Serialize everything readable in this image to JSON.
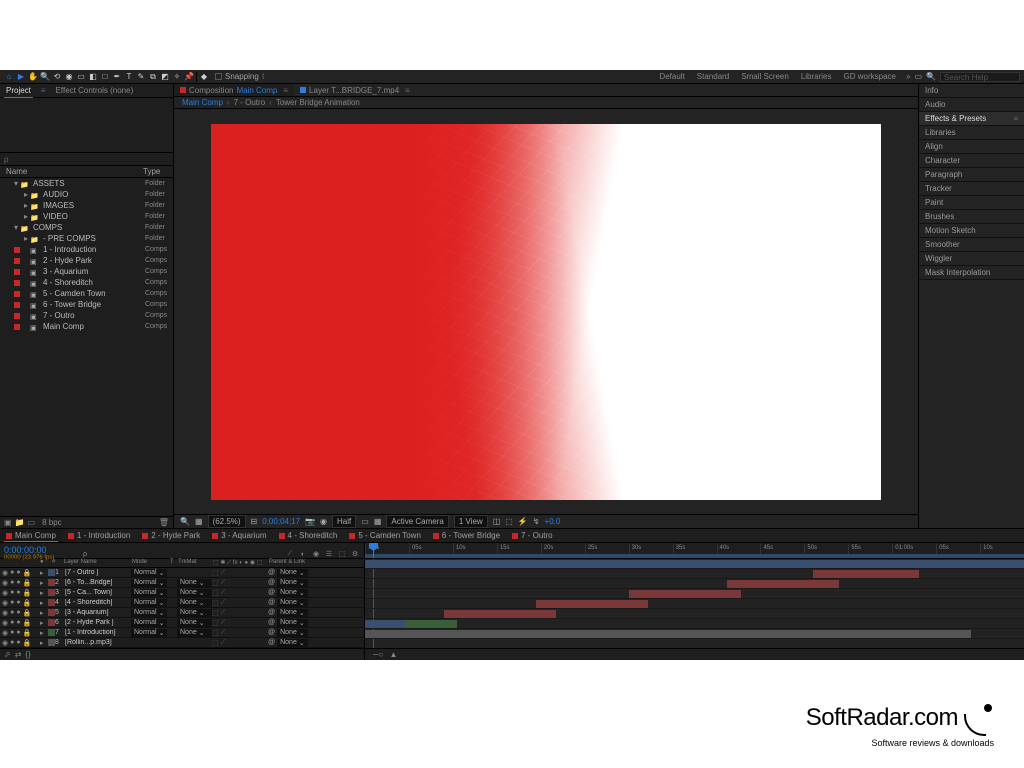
{
  "toolbar": {
    "snapping_label": "Snapping",
    "workspaces": [
      "Default",
      "Standard",
      "Small Screen",
      "Libraries",
      "GD workspace"
    ],
    "search_placeholder": "Search Help"
  },
  "project_panel": {
    "tabs": [
      "Project",
      "Effect Controls (none)"
    ],
    "header_name": "Name",
    "header_type": "Type",
    "search_placeholder": "ρ",
    "tree": [
      {
        "label": "ASSETS",
        "type": "Folder",
        "kind": "folder",
        "depth": 0,
        "swatch": "none",
        "open": true
      },
      {
        "label": "AUDIO",
        "type": "Folder",
        "kind": "folder",
        "depth": 1,
        "swatch": "none"
      },
      {
        "label": "IMAGES",
        "type": "Folder",
        "kind": "folder",
        "depth": 1,
        "swatch": "none"
      },
      {
        "label": "VIDEO",
        "type": "Folder",
        "kind": "folder",
        "depth": 1,
        "swatch": "none"
      },
      {
        "label": "COMPS",
        "type": "Folder",
        "kind": "folder",
        "depth": 0,
        "swatch": "none",
        "open": true
      },
      {
        "label": "- PRE COMPS",
        "type": "Folder",
        "kind": "folder",
        "depth": 1,
        "swatch": "none"
      },
      {
        "label": "1 - Introduction",
        "type": "Comps",
        "kind": "comp",
        "depth": 1,
        "swatch": "#c62828"
      },
      {
        "label": "2 - Hyde Park",
        "type": "Comps",
        "kind": "comp",
        "depth": 1,
        "swatch": "#c62828"
      },
      {
        "label": "3 - Aquarium",
        "type": "Comps",
        "kind": "comp",
        "depth": 1,
        "swatch": "#c62828"
      },
      {
        "label": "4 - Shoreditch",
        "type": "Comps",
        "kind": "comp",
        "depth": 1,
        "swatch": "#c62828"
      },
      {
        "label": "5 - Camden Town",
        "type": "Comps",
        "kind": "comp",
        "depth": 1,
        "swatch": "#c62828"
      },
      {
        "label": "6 - Tower Bridge",
        "type": "Comps",
        "kind": "comp",
        "depth": 1,
        "swatch": "#c62828"
      },
      {
        "label": "7 - Outro",
        "type": "Comps",
        "kind": "comp",
        "depth": 1,
        "swatch": "#c62828"
      },
      {
        "label": "Main Comp",
        "type": "Comps",
        "kind": "comp",
        "depth": 1,
        "swatch": "#c62828"
      }
    ]
  },
  "viewer": {
    "tabs": [
      {
        "sq": "#c62828",
        "lbl": "Composition",
        "name": "Main Comp",
        "active": true
      },
      {
        "sq": "#2a7de1",
        "lbl": "Layer T...BRIDGE_7.mp4",
        "name": "",
        "active": false
      }
    ],
    "breadcrumb": [
      "Main Comp",
      "7 - Outro",
      "Tower Bridge Animation"
    ],
    "controls": {
      "zoom": "(62.5%)",
      "timecode": "0;00;04;17",
      "res": "Half",
      "camera": "Active Camera",
      "view": "1 View",
      "exposure": "+0.0"
    }
  },
  "right_panels": [
    "Info",
    "Audio",
    "Effects & Presets",
    "Libraries",
    "Align",
    "Character",
    "Paragraph",
    "Tracker",
    "Paint",
    "Brushes",
    "Motion Sketch",
    "Smoother",
    "Wiggler",
    "Mask Interpolation"
  ],
  "timeline": {
    "tabs": [
      "Main Comp",
      "1 - Introduction",
      "2 - Hyde Park",
      "3 - Aquarium",
      "4 - Shoreditch",
      "5 - Camden Town",
      "6 - Tower Bridge",
      "7 - Outro"
    ],
    "timecode": "0:00:00:00",
    "timestamp": "00000 (23.976 fps)",
    "col_layer": "Layer Name",
    "col_mode": "Mode",
    "col_trk": "TrkMat",
    "col_sw": "Switches",
    "col_parent": "Parent & Link",
    "layers": [
      {
        "color": "#3a4e6e",
        "num": "1",
        "name": "[7 - Outro ]",
        "mode": "Normal",
        "trk": "",
        "parent": "None"
      },
      {
        "color": "#7a3838",
        "num": "2",
        "name": "[6 - To...Bridge]",
        "mode": "Normal",
        "trk": "None",
        "parent": "None"
      },
      {
        "color": "#7a3838",
        "num": "3",
        "name": "[5 - Ca... Town]",
        "mode": "Normal",
        "trk": "None",
        "parent": "None"
      },
      {
        "color": "#7a3838",
        "num": "4",
        "name": "[4 - Shoreditch]",
        "mode": "Normal",
        "trk": "None",
        "parent": "None"
      },
      {
        "color": "#7a3838",
        "num": "5",
        "name": "[3 - Aquarium]",
        "mode": "Normal",
        "trk": "None",
        "parent": "None"
      },
      {
        "color": "#7a3838",
        "num": "6",
        "name": "[2 - Hyde Park ]",
        "mode": "Normal",
        "trk": "None",
        "parent": "None"
      },
      {
        "color": "#3a5e3a",
        "num": "7",
        "name": "[1 - Introduction]",
        "mode": "Normal",
        "trk": "None",
        "parent": "None"
      },
      {
        "color": "#555",
        "num": "8",
        "name": "[Rollin...p.mp3]",
        "mode": "",
        "trk": "",
        "parent": "None"
      }
    ],
    "ruler": [
      ":00s",
      "05s",
      "10s",
      "15s",
      "20s",
      "25s",
      "30s",
      "35s",
      "40s",
      "45s",
      "50s",
      "55s",
      "01:00s",
      "05s",
      "10s"
    ],
    "bars": [
      {
        "row": 0,
        "cls": "blue",
        "l": 0,
        "w": 100
      },
      {
        "row": 1,
        "cls": "red",
        "l": 68,
        "w": 16
      },
      {
        "row": 2,
        "cls": "red",
        "l": 55,
        "w": 17
      },
      {
        "row": 3,
        "cls": "red",
        "l": 40,
        "w": 17
      },
      {
        "row": 4,
        "cls": "red",
        "l": 26,
        "w": 17
      },
      {
        "row": 5,
        "cls": "red",
        "l": 12,
        "w": 17
      },
      {
        "row": 6,
        "cls": "green",
        "l": 0,
        "w": 14
      },
      {
        "row": 6,
        "cls": "blue",
        "l": 0,
        "w": 6
      },
      {
        "row": 7,
        "cls": "grey",
        "l": 0,
        "w": 92
      }
    ]
  },
  "watermark": {
    "title": "SoftRadar.com",
    "sub": "Software reviews & downloads"
  }
}
